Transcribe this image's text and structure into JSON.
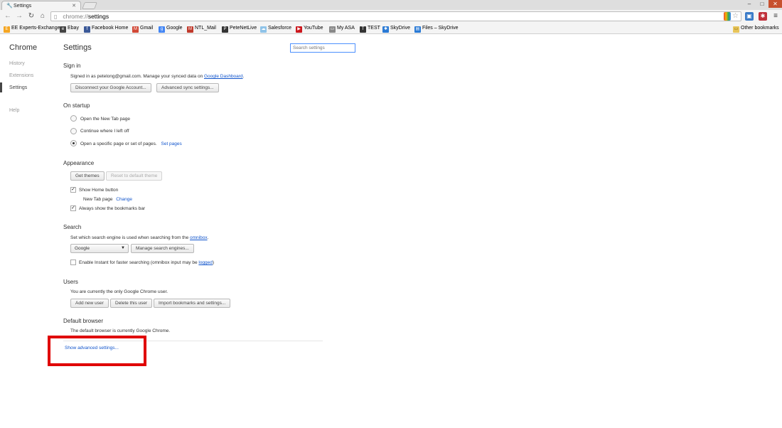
{
  "window": {
    "tab_title": "Settings",
    "tab_icon": "wrench-icon",
    "controls": {
      "minimize": "–",
      "maximize": "□",
      "close": "✕"
    }
  },
  "toolbar": {
    "url_scheme": "chrome://",
    "url_path": "settings"
  },
  "bookmarks": [
    {
      "label": "EE Experts-Exchange",
      "color": "#f5a623",
      "glyph": "E"
    },
    {
      "label": "Ebay",
      "color": "#444444",
      "glyph": "e"
    },
    {
      "label": "Facebook Home",
      "color": "#3b5998",
      "glyph": "f"
    },
    {
      "label": "Gmail",
      "color": "#d14836",
      "glyph": "M"
    },
    {
      "label": "Google",
      "color": "#4285f4",
      "glyph": "g"
    },
    {
      "label": "NTL_Mail",
      "color": "#c0392b",
      "glyph": "M"
    },
    {
      "label": "PeteNetLive",
      "color": "#333333",
      "glyph": "P"
    },
    {
      "label": "Salesforce",
      "color": "#8fc3e8",
      "glyph": "☁"
    },
    {
      "label": "YouTube",
      "color": "#cc181e",
      "glyph": "▶"
    },
    {
      "label": "My ASA",
      "color": "#888888",
      "glyph": "▭"
    },
    {
      "label": "TEST",
      "color": "#333333",
      "glyph": "T"
    },
    {
      "label": "SkyDrive",
      "color": "#2a7ad5",
      "glyph": "✱"
    },
    {
      "label": "Files – SkyDrive",
      "color": "#2a7ad5",
      "glyph": "▤"
    }
  ],
  "other_bookmarks": "Other bookmarks",
  "sidebar": {
    "title": "Chrome",
    "items": [
      "History",
      "Extensions",
      "Settings",
      "Help"
    ]
  },
  "page": {
    "title": "Settings",
    "search_placeholder": "Search settings"
  },
  "sign_in": {
    "title": "Sign in",
    "text": "Signed in as petelong@gmail.com. Manage your synced data on",
    "link": "Google Dashboard",
    "link_suffix": ".",
    "disconnect": "Disconnect your Google Account...",
    "advanced_sync": "Advanced sync settings..."
  },
  "startup": {
    "title": "On startup",
    "options": [
      "Open the New Tab page",
      "Continue where I left off",
      "Open a specific page or set of pages."
    ],
    "set_pages": "Set pages"
  },
  "appearance": {
    "title": "Appearance",
    "get_themes": "Get themes",
    "reset_default": "Reset to default theme",
    "show_home": "Show Home button",
    "home_page": "New Tab page",
    "change": "Change",
    "show_bookmarks": "Always show the bookmarks bar"
  },
  "search": {
    "title": "Search",
    "text": "Set which search engine is used when searching from the",
    "omnibox": "omnibox",
    "omnibox_suffix": ".",
    "engine": "Google",
    "manage": "Manage search engines...",
    "instant": "Enable Instant for faster searching (omnibox input may be",
    "logged": "logged",
    "instant_suffix": ")"
  },
  "users": {
    "title": "Users",
    "text": "You are currently the only Google Chrome user.",
    "add": "Add new user",
    "delete": "Delete this user",
    "import": "Import bookmarks and settings..."
  },
  "default_browser": {
    "title": "Default browser",
    "text": "The default browser is currently Google Chrome."
  },
  "advanced_link": "Show advanced settings..."
}
